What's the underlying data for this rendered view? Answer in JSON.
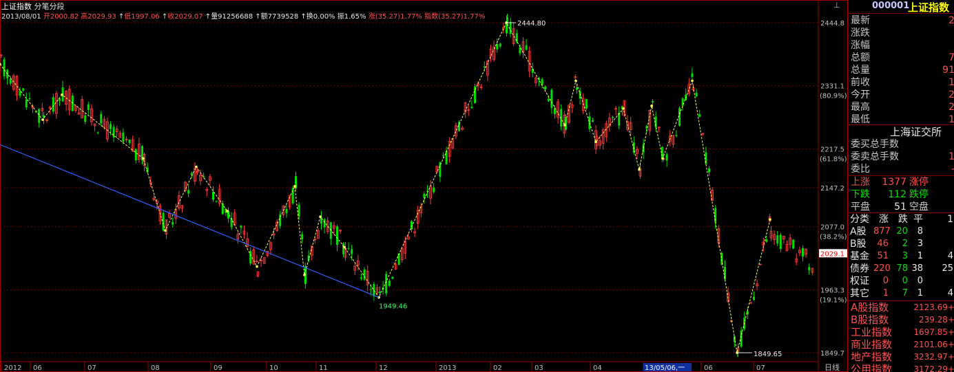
{
  "header": {
    "title": "上证指数",
    "mode": "分笔分段",
    "date": "2013/08/01",
    "open": "开2000.82",
    "high": "高2029.93",
    "low": "低1997.06",
    "close": "收2029.07",
    "volume": "量91256688",
    "amount": "额7739528",
    "turnover": "换0.00%",
    "amplitude": "振1.65%",
    "change": "涨(35.27)1.77%",
    "index_change": "指数(35.27)1.77%"
  },
  "chart_data": {
    "type": "candlestick",
    "title": "上证指数",
    "y_axis_labels": [
      {
        "value": 2444.8,
        "label": "2444.8"
      },
      {
        "value": 2331.1,
        "label": "2331.1",
        "pct": "(80.9%)"
      },
      {
        "value": 2217.5,
        "label": "2217.5",
        "pct": "(61.8%)"
      },
      {
        "value": 2147.2,
        "label": "2147.2"
      },
      {
        "value": 2077.0,
        "label": "2077.0",
        "pct": "(38.2%)"
      },
      {
        "value": 2029.1,
        "label": "2029.1",
        "current": true
      },
      {
        "value": 1963.3,
        "label": "1963.3",
        "pct": "(19.1%)"
      },
      {
        "value": 1849.7,
        "label": "1849.7"
      }
    ],
    "ylim": [
      1849.7,
      2444.8
    ],
    "x_axis_labels": [
      "2012",
      "06",
      "07",
      "08",
      "09",
      "10",
      "11",
      "12",
      "2013",
      "02",
      "03",
      "04",
      "13/05/06,一",
      "06",
      "07"
    ],
    "x_axis_right_label": "日线",
    "annotations": [
      {
        "label": "2444.80",
        "value": 2444.8
      },
      {
        "label": "1949.46",
        "value": 1949.46
      },
      {
        "label": "1849.65",
        "value": 1849.65
      }
    ],
    "zigzag_pivots": [
      2370,
      2270,
      2315,
      2200,
      2070,
      2185,
      2105,
      2005,
      2150,
      1990,
      2095,
      2040,
      1949.46,
      2444.8,
      2260,
      2340,
      2230,
      2290,
      2180,
      2295,
      2200,
      2340,
      1849.65,
      2090
    ]
  },
  "panel": {
    "code": "000001",
    "title": "上证指数",
    "quote_rows": [
      {
        "label": "最新",
        "value": "2"
      },
      {
        "label": "涨跌",
        "value": ""
      },
      {
        "label": "涨幅",
        "value": ""
      },
      {
        "label": "总额",
        "value": "7"
      },
      {
        "label": "总量",
        "value": "91"
      },
      {
        "label": "前收",
        "value": "1"
      },
      {
        "label": "今开",
        "value": "2"
      },
      {
        "label": "最高",
        "value": "2"
      },
      {
        "label": "最低",
        "value": "1"
      }
    ],
    "exchange": "上海证交所",
    "commission": [
      {
        "label": "委买总手数",
        "value": ""
      },
      {
        "label": "委卖总手数",
        "value": "1"
      },
      {
        "label": "委比",
        "value": "-"
      }
    ],
    "breadth": [
      {
        "label": "上涨",
        "value": "1377",
        "label2": "涨停"
      },
      {
        "label": "下跌",
        "value": "112",
        "label2": "跌停"
      },
      {
        "label": "平盘",
        "value": "51",
        "label2": "空盘"
      }
    ],
    "category_header": [
      "分类",
      "涨",
      "跌",
      "平",
      "1"
    ],
    "categories": [
      {
        "name": "A股",
        "up": "877",
        "down": "20",
        "flat": "8",
        "extra": ""
      },
      {
        "name": "B股",
        "up": "46",
        "down": "2",
        "flat": "3",
        "extra": ""
      },
      {
        "name": "基金",
        "up": "51",
        "down": "3",
        "flat": "1",
        "extra": "4"
      },
      {
        "name": "债券",
        "up": "220",
        "down": "78",
        "flat": "38",
        "extra": "25"
      },
      {
        "name": "权证",
        "up": "0",
        "down": "0",
        "flat": "0",
        "extra": ""
      },
      {
        "name": "其它",
        "up": "1",
        "down": "7",
        "flat": "1",
        "extra": "4"
      }
    ],
    "indices": [
      {
        "name": "A股指数",
        "value": "2123.69+"
      },
      {
        "name": "B股指数",
        "value": "239.28+"
      },
      {
        "name": "工业指数",
        "value": "1697.85+"
      },
      {
        "name": "商业指数",
        "value": "2101.06+"
      },
      {
        "name": "地产指数",
        "value": "3232.97+"
      },
      {
        "name": "公用指数",
        "value": "3172.29+"
      }
    ]
  }
}
